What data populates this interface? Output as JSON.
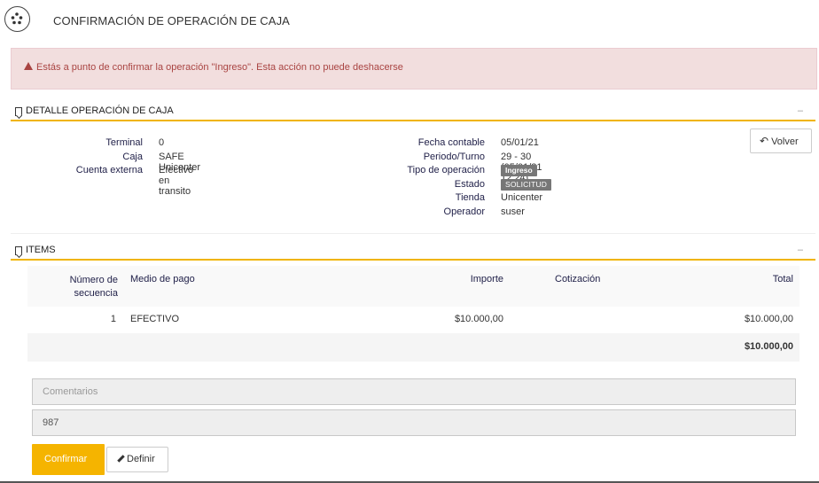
{
  "header": {
    "title": "CONFIRMACIÓN DE OPERACIÓN DE CAJA",
    "logo_icon": "flower-logo-icon"
  },
  "alert": {
    "message": "Estás a punto de confirmar la operación \"Ingreso\". Esta acción no puede deshacerse",
    "icon": "warning-icon",
    "color": "#a94442"
  },
  "detail": {
    "section_title": "DETALLE OPERACIÓN DE CAJA",
    "collapse_label": "–",
    "left": [
      {
        "label": "Terminal",
        "value": "0"
      },
      {
        "label": "Caja",
        "value": "SAFE Unicenter"
      },
      {
        "label": "Cuenta externa",
        "value": "Efectivo en transito"
      }
    ],
    "right": {
      "fecha_label": "Fecha contable",
      "fecha_value": "05/01/21",
      "periodo_label": "Periodo/Turno",
      "periodo_value": "29 - 30 (05/01/21 12:24)",
      "tipo_label": "Tipo de operación",
      "tipo_value": "Ingreso",
      "estado_label": "Estado",
      "estado_value": "SOLICITUD",
      "tienda_label": "Tienda",
      "tienda_value": "Unicenter",
      "operador_label": "Operador",
      "operador_value": "suser"
    },
    "back_button": "Volver"
  },
  "items": {
    "section_title": "ITEMS",
    "collapse_label": "–",
    "columns": {
      "seq_line1": "Número de",
      "seq_line2": "secuencia",
      "medio": "Medio de pago",
      "importe": "Importe",
      "cotizacion": "Cotización",
      "total": "Total"
    },
    "rows": [
      {
        "seq": "1",
        "medio": "EFECTIVO",
        "importe": "$10.000,00",
        "cotizacion": "",
        "total": "$10.000,00"
      }
    ],
    "grand_total": "$10.000,00"
  },
  "form": {
    "comments_placeholder": "Comentarios",
    "code_value": "987"
  },
  "actions": {
    "confirm": "Confirmar",
    "define": "Definir"
  },
  "colors": {
    "accent": "#f5b400",
    "badge": "#777777"
  }
}
